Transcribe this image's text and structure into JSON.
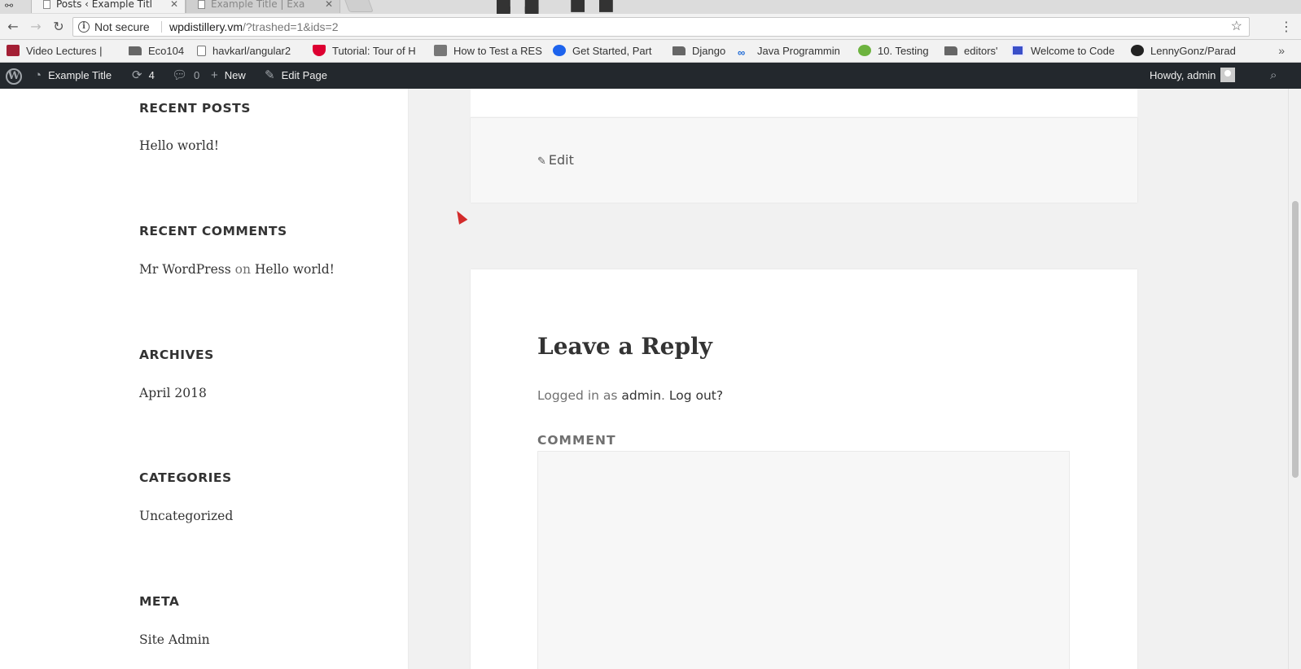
{
  "browser": {
    "tabs": [
      {
        "title": "Posts ‹ Example Titl",
        "active": true
      },
      {
        "title": "Example Title | Exa",
        "active": false
      }
    ],
    "omnibox": {
      "security_label": "Not secure",
      "url_host": "wpdistillery.vm",
      "url_rest": "/?trashed=1&ids=2"
    },
    "bookmarks": [
      {
        "label": "Video Lectures | ",
        "icon": "mit-ocw-icon",
        "color": "#a31f34"
      },
      {
        "label": "Eco104",
        "icon": "folder-icon"
      },
      {
        "label": "havkarl/angular2",
        "icon": "document-icon"
      },
      {
        "label": "Tutorial: Tour of H",
        "icon": "angular-icon",
        "color": "#dd0031"
      },
      {
        "label": "How to Test a RES",
        "icon": "flask-icon",
        "color": "#555"
      },
      {
        "label": "Get Started, Part",
        "icon": "docker-icon",
        "color": "#1d63ed"
      },
      {
        "label": "Django",
        "icon": "folder-icon"
      },
      {
        "label": "Java Programmin",
        "icon": "infinity-icon",
        "color": "#1f6bd6"
      },
      {
        "label": "10. Testing",
        "icon": "spring-icon",
        "color": "#6db33f"
      },
      {
        "label": "editors'",
        "icon": "folder-icon"
      },
      {
        "label": "Welcome to Code",
        "icon": "codewars-icon",
        "color": "#3a4fc8"
      },
      {
        "label": "LennyGonz/Parad",
        "icon": "github-icon",
        "color": "#222"
      }
    ]
  },
  "adminbar": {
    "site_name": "Example Title",
    "updates_count": "4",
    "comments_count": "0",
    "new_label": "New",
    "edit_page_label": "Edit Page",
    "greeting": "Howdy, admin"
  },
  "sidebar": {
    "widgets": [
      {
        "title": "Recent Posts",
        "items": [
          "Hello world!"
        ]
      },
      {
        "title": "Recent Comments",
        "comment": {
          "author": "Mr WordPress",
          "joiner": "on",
          "post": "Hello world!"
        }
      },
      {
        "title": "Archives",
        "items": [
          "April 2018"
        ]
      },
      {
        "title": "Categories",
        "items": [
          "Uncategorized"
        ]
      },
      {
        "title": "Meta",
        "items": [
          "Site Admin"
        ]
      }
    ]
  },
  "post": {
    "edit_label": "Edit"
  },
  "comments": {
    "reply_title": "Leave a Reply",
    "logged_in_prefix": "Logged in as",
    "logged_in_user": "admin",
    "logout_label": "Log out?",
    "comment_label": "Comment",
    "comment_value": ""
  }
}
